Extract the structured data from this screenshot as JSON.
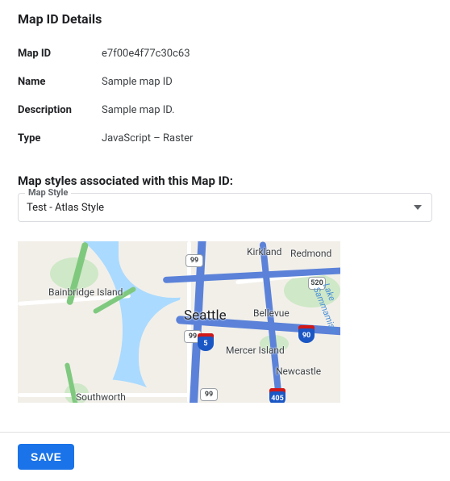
{
  "details": {
    "title": "Map ID Details",
    "rows": [
      {
        "label": "Map ID",
        "value": "e7f00e4f77c30c63"
      },
      {
        "label": "Name",
        "value": "Sample map ID"
      },
      {
        "label": "Description",
        "value": "Sample map ID."
      },
      {
        "label": "Type",
        "value": "JavaScript – Raster"
      }
    ]
  },
  "styles_section": {
    "title": "Map styles associated with this Map ID:",
    "field_label": "Map Style",
    "selected": "Test - Atlas Style"
  },
  "map": {
    "cities": {
      "seattle": "Seattle",
      "bellevue": "Bellevue",
      "kirkland": "Kirkland",
      "redmond": "Redmond",
      "bainbridge": "Bainbridge Island",
      "mercer": "Mercer Island",
      "newcastle": "Newcastle",
      "southworth": "Southworth"
    },
    "lake": "Lake Sammamish",
    "shields": {
      "s99a": "99",
      "s99b": "99",
      "s99c": "99",
      "s520": "520",
      "i5": "5",
      "i90": "90",
      "i405": "405"
    }
  },
  "actions": {
    "save": "SAVE"
  }
}
